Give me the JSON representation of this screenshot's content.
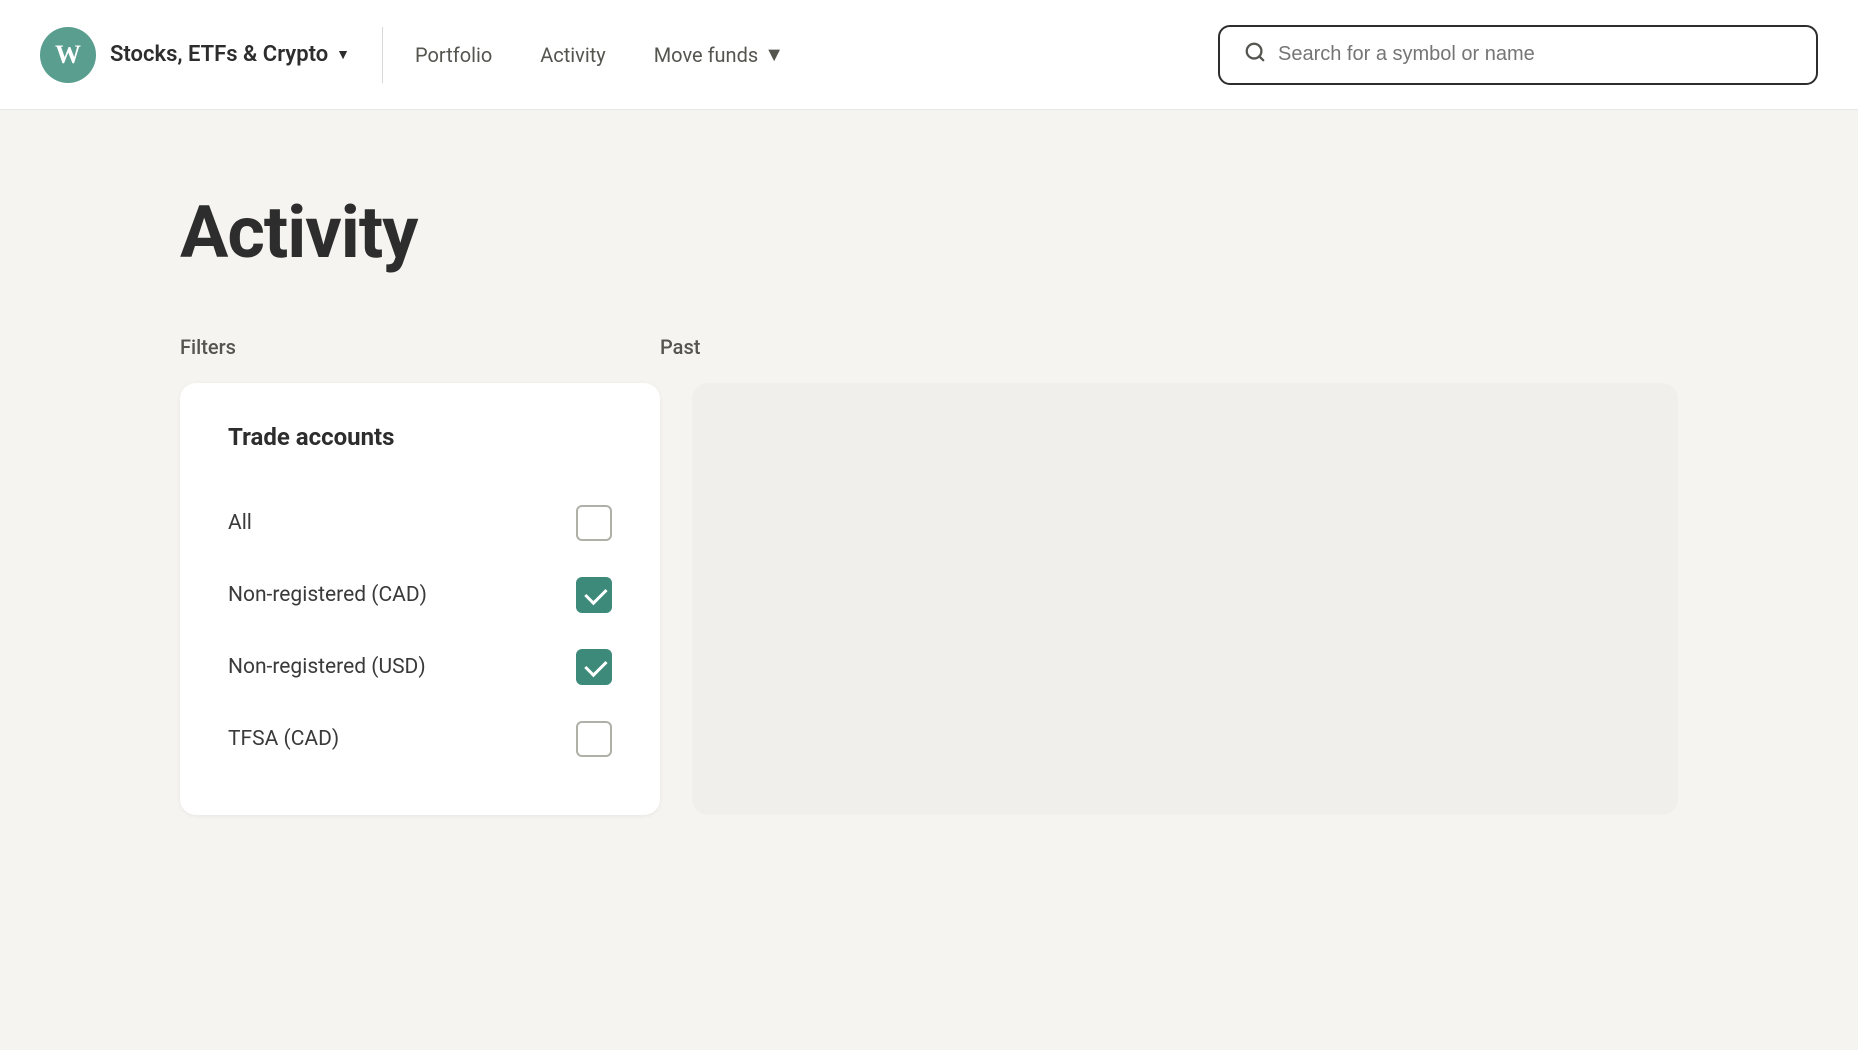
{
  "header": {
    "logo_letter": "W",
    "brand_label": "Stocks, ETFs & Crypto",
    "nav_items": [
      {
        "label": "Portfolio",
        "has_dropdown": false
      },
      {
        "label": "Activity",
        "has_dropdown": false
      },
      {
        "label": "Move funds",
        "has_dropdown": true
      }
    ],
    "search_placeholder": "Search for a symbol or name"
  },
  "main": {
    "page_title": "Activity",
    "filters_label": "Filters",
    "past_label": "Past",
    "filter_card": {
      "title": "Trade accounts",
      "items": [
        {
          "label": "All",
          "checked": false
        },
        {
          "label": "Non-registered (CAD)",
          "checked": true
        },
        {
          "label": "Non-registered (USD)",
          "checked": true
        },
        {
          "label": "TFSA (CAD)",
          "checked": false
        }
      ]
    }
  },
  "colors": {
    "checked_bg": "#3d8a7a",
    "logo_bg": "#5a9e8f"
  }
}
